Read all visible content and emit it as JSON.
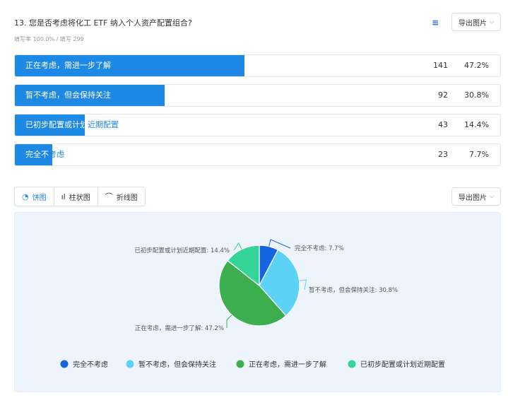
{
  "question": {
    "title": "13. 您是否考虑将化工 ETF 纳入个人资产配置组合?",
    "meta": "填写率 100.0% / 填写 299",
    "icon": "list-icon"
  },
  "export_label": "导出图片",
  "rows": [
    {
      "label": "正在考虑，需进一步了解",
      "count": "141",
      "pct": "47.2%"
    },
    {
      "label": "暂不考虑，但会保持关注",
      "count": "92",
      "pct": "30.8%"
    },
    {
      "label": "已初步配置或计划近期配置",
      "count": "43",
      "pct": "14.4%"
    },
    {
      "label": "完全不考虑",
      "count": "23",
      "pct": "7.7%"
    }
  ],
  "tabs": [
    {
      "label": "饼图",
      "icon": "pie-icon"
    },
    {
      "label": "柱状图",
      "icon": "bar-chart-icon"
    },
    {
      "label": "折线图",
      "icon": "line-chart-icon"
    }
  ],
  "chart_data": {
    "type": "pie",
    "slices": [
      {
        "name": "完全不考虑",
        "value": 7.7,
        "label": "完全不考虑: 7.7%",
        "color": "#1565e0"
      },
      {
        "name": "暂不考虑，但会保持关注",
        "value": 30.8,
        "label": "暂不考虑，但会保持关注: 30.8%",
        "color": "#5dd2f7"
      },
      {
        "name": "正在考虑，需进一步了解",
        "value": 47.2,
        "label": "正在考虑，需进一步了解: 47.2%",
        "color": "#3cae4f"
      },
      {
        "name": "已初步配置或计划近期配置",
        "value": 14.4,
        "label": "已初步配置或计划近期配置: 14.4%",
        "color": "#35d497"
      }
    ],
    "legend_position": "bottom"
  },
  "colors": {
    "accent": "#1e88e5"
  }
}
